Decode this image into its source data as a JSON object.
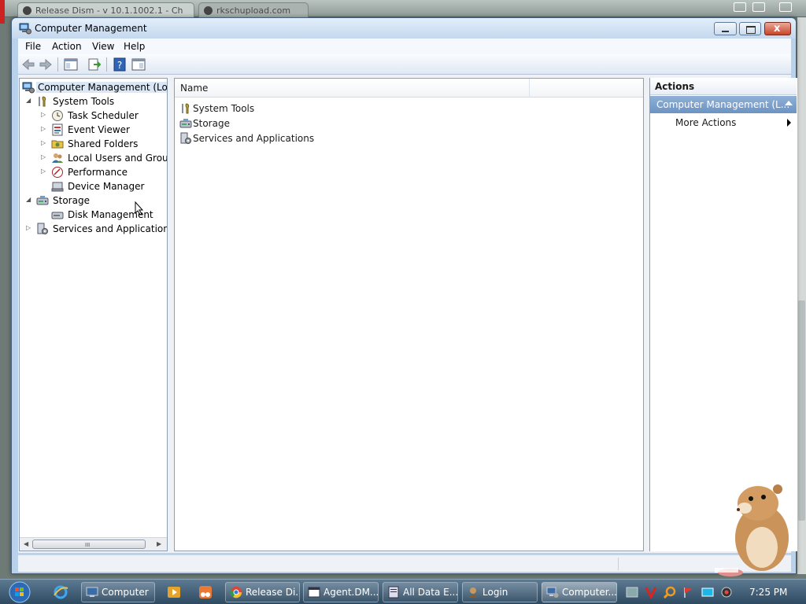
{
  "background": {
    "tab1_title": "Release Dism - v 10.1.1002.1 - Ch",
    "tab2_title": "rkschupload.com"
  },
  "window": {
    "title": "Computer Management",
    "close_glyph": "x"
  },
  "menu": {
    "file": "File",
    "action": "Action",
    "view": "View",
    "help": "Help"
  },
  "tree": {
    "root": "Computer Management (Local",
    "system_tools": "System Tools",
    "task_scheduler": "Task Scheduler",
    "event_viewer": "Event Viewer",
    "shared_folders": "Shared Folders",
    "local_users_groups": "Local Users and Groups",
    "performance": "Performance",
    "device_manager": "Device Manager",
    "storage": "Storage",
    "disk_management": "Disk Management",
    "services_apps": "Services and Applications",
    "scroll_grip": "III"
  },
  "list": {
    "column_name": "Name",
    "items": [
      "System Tools",
      "Storage",
      "Services and Applications"
    ]
  },
  "actions": {
    "header": "Actions",
    "section": "Computer Management (L...",
    "more_actions": "More Actions"
  },
  "taskbar": {
    "buttons": [
      "Computer",
      "Release Di...",
      "Agent.DM...",
      "All Data E...",
      "Login",
      "Computer..."
    ],
    "clock": "7:25 PM"
  },
  "colors": {
    "selection_blue": "#d9e7f7",
    "actions_section": "#7aa0cc",
    "taskbar": "#3d5a72"
  }
}
